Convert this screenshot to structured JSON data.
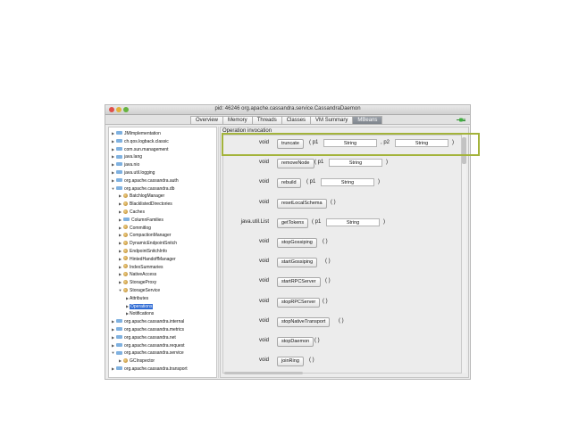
{
  "window": {
    "title": "pid: 46246 org.apache.cassandra.service.CassandraDaemon"
  },
  "tabs": [
    "Overview",
    "Memory",
    "Threads",
    "Classes",
    "VM Summary",
    "MBeans"
  ],
  "active_tab": "MBeans",
  "tree": [
    {
      "label": "JMImplementation",
      "icon": "folder-icon",
      "depth": 0,
      "expanded": false
    },
    {
      "label": "ch.qos.logback.classic",
      "icon": "folder-icon",
      "depth": 0,
      "expanded": false
    },
    {
      "label": "com.sun.management",
      "icon": "folder-icon",
      "depth": 0,
      "expanded": false
    },
    {
      "label": "java.lang",
      "icon": "folder-icon",
      "depth": 0,
      "expanded": false
    },
    {
      "label": "java.nio",
      "icon": "folder-icon",
      "depth": 0,
      "expanded": false
    },
    {
      "label": "java.util.logging",
      "icon": "folder-icon",
      "depth": 0,
      "expanded": false
    },
    {
      "label": "org.apache.cassandra.auth",
      "icon": "folder-icon",
      "depth": 0,
      "expanded": false
    },
    {
      "label": "org.apache.cassandra.db",
      "icon": "folder-icon",
      "depth": 0,
      "expanded": true
    },
    {
      "label": "BatchlogManager",
      "icon": "bean-icon",
      "depth": 1,
      "expanded": false
    },
    {
      "label": "BlacklistedDirectories",
      "icon": "bean-icon",
      "depth": 1,
      "expanded": false
    },
    {
      "label": "Caches",
      "icon": "bean-icon",
      "depth": 1,
      "expanded": false
    },
    {
      "label": "ColumnFamilies",
      "icon": "folder-icon",
      "depth": 1,
      "expanded": false
    },
    {
      "label": "Commitlog",
      "icon": "bean-icon",
      "depth": 1,
      "expanded": false
    },
    {
      "label": "CompactionManager",
      "icon": "bean-icon",
      "depth": 1,
      "expanded": false
    },
    {
      "label": "DynamicEndpointSnitch",
      "icon": "bean-icon",
      "depth": 1,
      "expanded": false
    },
    {
      "label": "EndpointSnitchInfo",
      "icon": "bean-icon",
      "depth": 1,
      "expanded": false
    },
    {
      "label": "HintedHandoffManager",
      "icon": "bean-icon",
      "depth": 1,
      "expanded": false
    },
    {
      "label": "IndexSummaries",
      "icon": "bean-icon",
      "depth": 1,
      "expanded": false
    },
    {
      "label": "NativeAccess",
      "icon": "bean-icon",
      "depth": 1,
      "expanded": false
    },
    {
      "label": "StorageProxy",
      "icon": "bean-icon",
      "depth": 1,
      "expanded": false
    },
    {
      "label": "StorageService",
      "icon": "bean-icon",
      "depth": 1,
      "expanded": true
    },
    {
      "label": "Attributes",
      "icon": "",
      "depth": 2,
      "expanded": false
    },
    {
      "label": "Operations",
      "icon": "",
      "depth": 2,
      "expanded": false,
      "selected": true
    },
    {
      "label": "Notifications",
      "icon": "",
      "depth": 2,
      "expanded": false
    },
    {
      "label": "org.apache.cassandra.internal",
      "icon": "folder-icon",
      "depth": 0,
      "expanded": false
    },
    {
      "label": "org.apache.cassandra.metrics",
      "icon": "folder-icon",
      "depth": 0,
      "expanded": false
    },
    {
      "label": "org.apache.cassandra.net",
      "icon": "folder-icon",
      "depth": 0,
      "expanded": false
    },
    {
      "label": "org.apache.cassandra.request",
      "icon": "folder-icon",
      "depth": 0,
      "expanded": false
    },
    {
      "label": "org.apache.cassandra.service",
      "icon": "folder-icon",
      "depth": 0,
      "expanded": true
    },
    {
      "label": "GCInspector",
      "icon": "bean-icon",
      "depth": 1,
      "expanded": false
    },
    {
      "label": "org.apache.cassandra.transport",
      "icon": "folder-icon",
      "depth": 0,
      "expanded": false
    }
  ],
  "operations_panel": {
    "header": "Operation invocation",
    "operations": [
      {
        "return_type": "void",
        "name": "truncate",
        "params": [
          {
            "label": "( p1",
            "value": "String"
          },
          {
            "label": ", p2",
            "value": "String"
          }
        ],
        "close": ")"
      },
      {
        "return_type": "void",
        "name": "removeNode",
        "params": [
          {
            "label": "( p1",
            "value": "String"
          }
        ],
        "close": ")"
      },
      {
        "return_type": "void",
        "name": "rebuild",
        "params": [
          {
            "label": "( p1",
            "value": "String"
          }
        ],
        "close": ")"
      },
      {
        "return_type": "void",
        "name": "resetLocalSchema",
        "params": [],
        "close": "( )"
      },
      {
        "return_type": "java.util.List",
        "name": "getTokens",
        "params": [
          {
            "label": "( p1",
            "value": "String"
          }
        ],
        "close": ")"
      },
      {
        "return_type": "void",
        "name": "stopGossiping",
        "params": [],
        "close": "( )"
      },
      {
        "return_type": "void",
        "name": "startGossiping",
        "params": [],
        "close": "( )"
      },
      {
        "return_type": "void",
        "name": "startRPCServer",
        "params": [],
        "close": "( )"
      },
      {
        "return_type": "void",
        "name": "stopRPCServer",
        "params": [],
        "close": "( )"
      },
      {
        "return_type": "void",
        "name": "stopNativeTransport",
        "params": [],
        "close": "( )"
      },
      {
        "return_type": "void",
        "name": "stopDaemon",
        "params": [],
        "close": "( )"
      },
      {
        "return_type": "void",
        "name": "joinRing",
        "params": [],
        "close": "( )"
      }
    ]
  },
  "colors": {
    "highlight_border": "#a3b33b",
    "selection": "#2f6bd4",
    "active_tab": "#7e848c"
  }
}
